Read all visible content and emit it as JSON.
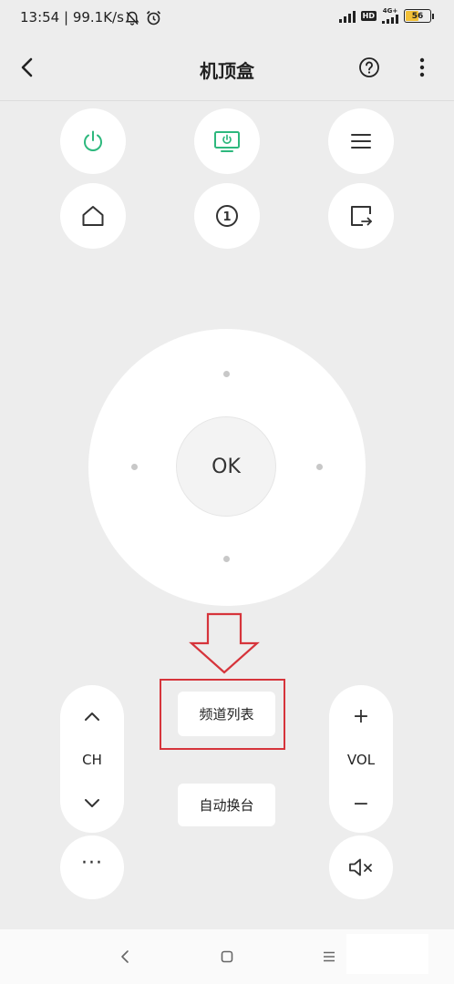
{
  "status_bar": {
    "time_speed": "13:54 | 99.1K/s",
    "hd": "HD",
    "network": "4G+",
    "battery": "56",
    "battery_level": 0.56
  },
  "app_bar": {
    "title": "机顶盒",
    "back_icon": "chevron-left-icon",
    "help_icon": "question-circle-icon",
    "more_icon": "vertical-dots-icon"
  },
  "top_buttons": [
    {
      "name": "power",
      "icon": "power-icon",
      "color": "#2db87d"
    },
    {
      "name": "tv",
      "icon": "tv-power-icon",
      "color": "#2db87d"
    },
    {
      "name": "menu",
      "icon": "menu-icon",
      "color": "#333333"
    },
    {
      "name": "home",
      "icon": "home-icon",
      "color": "#333333"
    },
    {
      "name": "number",
      "icon": "number-one-icon",
      "label": "1",
      "color": "#333333"
    },
    {
      "name": "input",
      "icon": "input-source-icon",
      "color": "#333333"
    }
  ],
  "dpad": {
    "ok_label": "OK"
  },
  "ch": {
    "label": "CH"
  },
  "vol": {
    "label": "VOL",
    "plus": "+",
    "minus": "−"
  },
  "center_buttons": {
    "channel_list": "频道列表",
    "auto_switch": "自动换台"
  },
  "more_label": "···",
  "colors": {
    "accent": "#2db87d",
    "annotation": "#d6343b",
    "background": "#ededed"
  }
}
